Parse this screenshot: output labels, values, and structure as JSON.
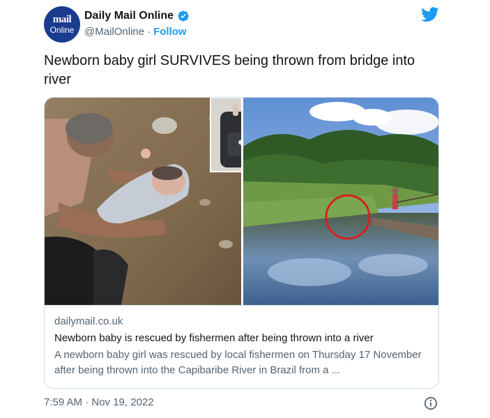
{
  "account": {
    "avatar_line1": "mail",
    "avatar_line2": "Online",
    "display_name": "Daily Mail Online",
    "handle": "@MailOnline",
    "separator": "·",
    "follow_label": "Follow"
  },
  "tweet": {
    "text": "Newborn baby girl SURVIVES being thrown from bridge into river"
  },
  "card": {
    "domain": "dailymail.co.uk",
    "title": "Newborn baby is rescued by fishermen after being thrown into a river",
    "description": "A newborn baby girl was rescued by local fishermen on Thursday 17 November after being thrown into the Capibaribe River in Brazil from a ..."
  },
  "meta": {
    "timestamp": "7:59 AM · Nov 19, 2022"
  },
  "icons": {
    "verified": "verified-badge-icon",
    "twitter": "twitter-bird-icon",
    "info": "info-icon"
  },
  "colors": {
    "accent": "#1d9bf0",
    "text_primary": "#0f1419",
    "text_secondary": "#536471",
    "border": "#cfd9de",
    "avatar_bg": "#1a3c8f",
    "circle_annotation": "#d6221a"
  }
}
